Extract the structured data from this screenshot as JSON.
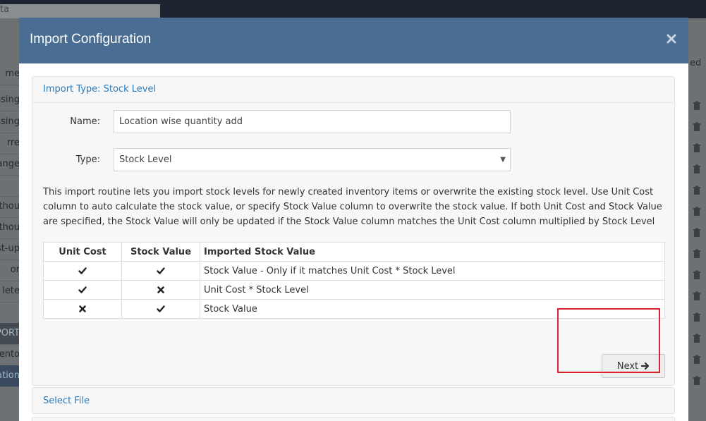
{
  "background": {
    "top_peek": "ta",
    "right_peek": "ed",
    "left_items": [
      {
        "label": "me",
        "style": "light"
      },
      {
        "label": "ssing",
        "style": "light"
      },
      {
        "label": "ssing",
        "style": "light"
      },
      {
        "label": "rre",
        "style": "light"
      },
      {
        "label": "ange",
        "style": "light"
      },
      {
        "label": "",
        "style": "light"
      },
      {
        "label": "thou",
        "style": "light"
      },
      {
        "label": "thou",
        "style": "light"
      },
      {
        "label": "st-up",
        "style": "light"
      },
      {
        "label": "or",
        "style": "light"
      },
      {
        "label": "lete",
        "style": "light"
      },
      {
        "label": "",
        "style": "light"
      },
      {
        "label": "PORT",
        "style": "dark"
      },
      {
        "label": "ento",
        "style": "light"
      },
      {
        "label": "cation",
        "style": "bluebar"
      }
    ]
  },
  "modal": {
    "title": "Import Configuration",
    "close_icon": "close-icon",
    "import_type_label": "Import Type: Stock Level",
    "form": {
      "name_label": "Name:",
      "name_value": "Location wise quantity add",
      "type_label": "Type:",
      "type_selected": "Stock Level"
    },
    "description": "This import routine lets you import stock levels for newly created inventory items or overwrite the existing stock level. Use Unit Cost column to auto calculate the stock value, or specify Stock Value column to overwrite the stock value. If both Unit Cost and Stock Value are specified, the Stock Value will only be updated if the Stock Value column matches the Unit Cost column multiplied by Stock Level",
    "table": {
      "headers": [
        "Unit Cost",
        "Stock Value",
        "Imported Stock Value"
      ],
      "rows": [
        {
          "unit_cost": "check-icon",
          "stock_value": "check-icon",
          "result": "Stock Value - Only if it matches Unit Cost * Stock Level"
        },
        {
          "unit_cost": "check-icon",
          "stock_value": "cross-icon",
          "result": "Unit Cost * Stock Level"
        },
        {
          "unit_cost": "cross-icon",
          "stock_value": "check-icon",
          "result": "Stock Value"
        }
      ]
    },
    "next_button": {
      "label": "Next",
      "icon": "arrow-right-icon"
    },
    "select_file_label": "Select File",
    "highlight_color": "#d9232d",
    "header_color": "#4a6d93",
    "link_color": "#2a7ab9"
  }
}
